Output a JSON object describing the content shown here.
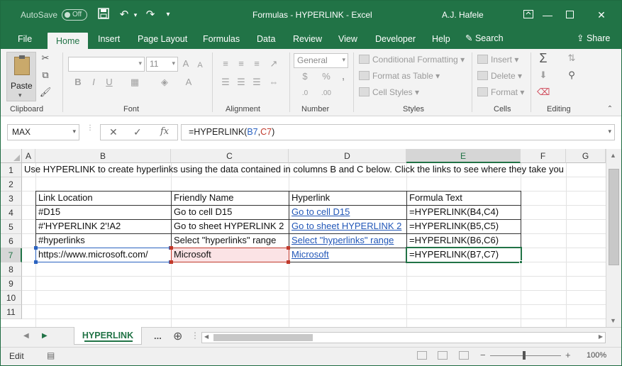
{
  "window": {
    "autosave_label": "AutoSave",
    "autosave_state": "Off",
    "title": "Formulas - HYPERLINK  -  Excel",
    "user": "A.J. Hafele"
  },
  "tabs": [
    "File",
    "Home",
    "Insert",
    "Page Layout",
    "Formulas",
    "Data",
    "Review",
    "View",
    "Developer",
    "Help"
  ],
  "search_label": "Search",
  "share_label": "Share",
  "ribbon": {
    "paste_label": "Paste",
    "font_size": "11",
    "number_format": "General",
    "conditional_formatting": "Conditional Formatting",
    "format_as_table": "Format as Table",
    "cell_styles": "Cell Styles",
    "insert": "Insert",
    "delete": "Delete",
    "format": "Format",
    "groups": {
      "clipboard": "Clipboard",
      "font": "Font",
      "alignment": "Alignment",
      "number": "Number",
      "styles": "Styles",
      "cells": "Cells",
      "editing": "Editing"
    }
  },
  "formula_bar": {
    "name_box": "MAX",
    "formula_prefix": "=HYPERLINK(",
    "ref1": "B7",
    "comma": ",",
    "ref2": "C7",
    "formula_suffix": ")"
  },
  "columns": [
    "A",
    "B",
    "C",
    "D",
    "E",
    "F",
    "G"
  ],
  "rows": [
    "1",
    "2",
    "3",
    "4",
    "5",
    "6",
    "7",
    "8",
    "9",
    "10",
    "11"
  ],
  "sheet": {
    "r1": "Use HYPERLINK to create hyperlinks using the data contained in columns B and C below. Click the links to see where they take you",
    "headers": [
      "Link Location",
      "Friendly Name",
      "Hyperlink",
      "Formula Text"
    ],
    "data": [
      [
        "#D15",
        "Go to cell D15",
        "Go to cell D15",
        "=HYPERLINK(B4,C4)"
      ],
      [
        "#'HYPERLINK 2'!A2",
        "Go to sheet HYPERLINK 2",
        "Go to sheet HYPERLINK 2",
        "=HYPERLINK(B5,C5)"
      ],
      [
        "#hyperlinks",
        "Select \"hyperlinks\" range",
        "Select \"hyperlinks\" range",
        "=HYPERLINK(B6,C6)"
      ],
      [
        "https://www.microsoft.com/",
        "Microsoft",
        "Microsoft",
        "=HYPERLINK(B7,C7)"
      ]
    ]
  },
  "sheet_tabs": {
    "active": "HYPERLINK",
    "more": "..."
  },
  "status": {
    "mode": "Edit",
    "zoom": "100%"
  },
  "colors": {
    "accent": "#217346",
    "link": "#2257b8",
    "ref_blue": "#2a62c0",
    "ref_red": "#c0392b"
  }
}
